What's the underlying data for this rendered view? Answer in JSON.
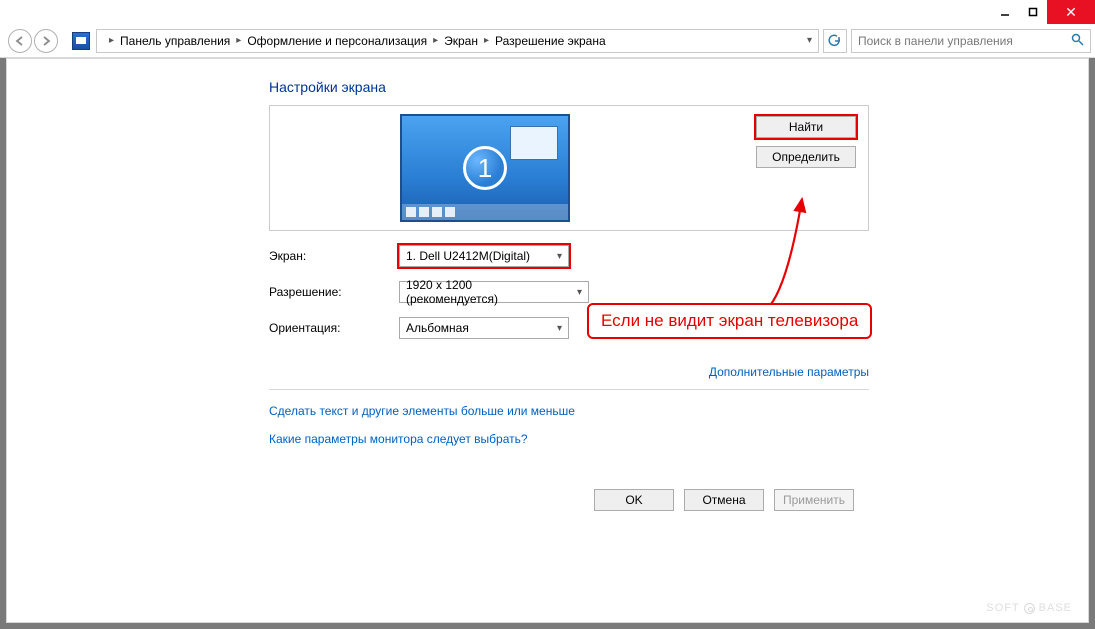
{
  "titlebar": {
    "close_glyph": "✕"
  },
  "breadcrumb": {
    "items": [
      "Панель управления",
      "Оформление и персонализация",
      "Экран",
      "Разрешение экрана"
    ]
  },
  "search": {
    "placeholder": "Поиск в панели управления"
  },
  "page": {
    "title": "Настройки экрана"
  },
  "buttons": {
    "detect": "Найти",
    "identify": "Определить",
    "ok": "OK",
    "cancel": "Отмена",
    "apply": "Применить"
  },
  "monitor_number": "1",
  "form": {
    "display_label": "Экран:",
    "display_value": "1. Dell U2412M(Digital)",
    "resolution_label": "Разрешение:",
    "resolution_value": "1920 x 1200 (рекомендуется)",
    "orientation_label": "Ориентация:",
    "orientation_value": "Альбомная"
  },
  "links": {
    "advanced": "Дополнительные параметры",
    "textsize": "Сделать текст и другие элементы больше или меньше",
    "whichsettings": "Какие параметры монитора следует выбрать?"
  },
  "callout": {
    "text": "Если не видит экран телевизора"
  },
  "watermark": {
    "left": "SOFT",
    "right": "BASE"
  }
}
